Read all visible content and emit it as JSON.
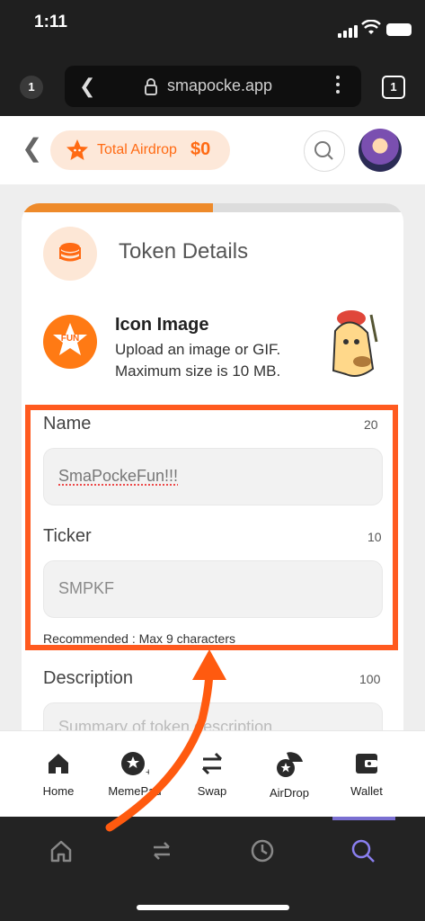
{
  "status_bar": {
    "time": "1:11"
  },
  "browser": {
    "tab_badge": "1",
    "url": "smapocke.app",
    "tab_count": "1"
  },
  "header": {
    "airdrop_label": "Total Airdrop",
    "airdrop_value": "$0"
  },
  "progress": {
    "fraction": 0.5
  },
  "token_details": {
    "title": "Token Details",
    "icon_image": {
      "title": "Icon Image",
      "desc_line1": "Upload an image or GIF.",
      "desc_line2": "Maximum size is 10 MB.",
      "logo_text": "FUN"
    }
  },
  "fields": {
    "name": {
      "label": "Name",
      "limit": "20",
      "value": "SmaPockeFun!!!"
    },
    "ticker": {
      "label": "Ticker",
      "limit": "10",
      "value": "SMPKF"
    },
    "recommended": "Recommended : Max 9 characters",
    "description": {
      "label": "Description",
      "limit": "100",
      "placeholder": "Summary of token description"
    }
  },
  "bottom_nav": {
    "items": [
      {
        "label": "Home",
        "icon": "house-icon"
      },
      {
        "label": "MemePad",
        "icon": "meme-add-icon"
      },
      {
        "label": "Swap",
        "icon": "swap-arrows-icon"
      },
      {
        "label": "AirDrop",
        "icon": "airdrop-icon"
      },
      {
        "label": "Wallet",
        "icon": "wallet-icon"
      }
    ]
  },
  "browser_toolbar": {
    "icons": [
      "home-icon",
      "tabs-switch-icon",
      "history-icon",
      "search-icon"
    ],
    "active": "search-icon"
  },
  "colors": {
    "accent": "#ff6a13",
    "highlight": "#ff5a1f",
    "toolbar_active": "#7a6fd1"
  }
}
